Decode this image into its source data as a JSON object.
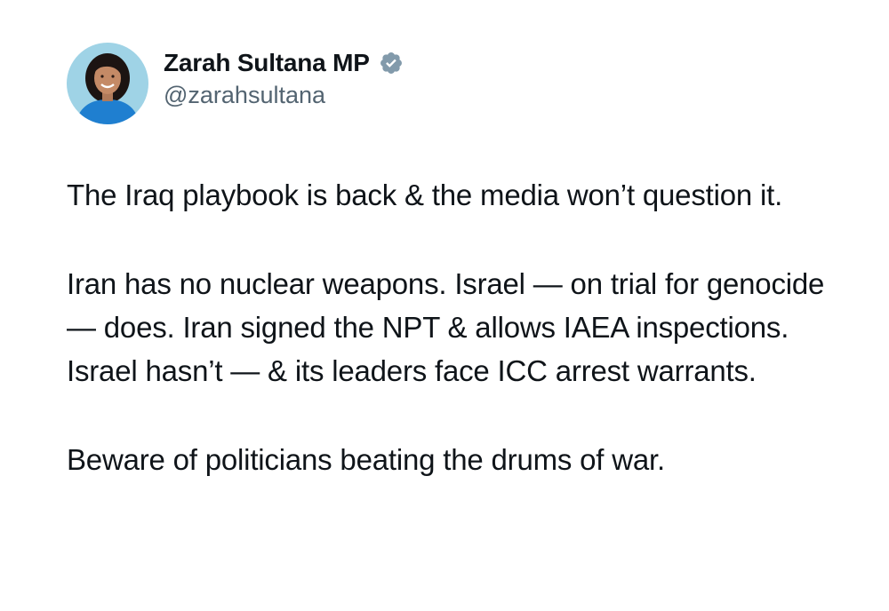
{
  "author": {
    "display_name": "Zarah Sultana MP",
    "handle": "@zarahsultana",
    "verified": true,
    "verified_badge_color": "#829aab",
    "avatar_icon": "profile-photo"
  },
  "tweet": {
    "paragraphs": [
      "The Iraq playbook is back & the media won’t question it.",
      "Iran has no nuclear weapons. Israel — on trial for genocide — does. Iran signed the NPT & allows IAEA inspections. Israel hasn’t — & its leaders face ICC arrest warrants.",
      "Beware of politicians beating the drums of war."
    ]
  },
  "colors": {
    "background": "#ffffff",
    "text": "#0f1419",
    "secondary_text": "#536471",
    "avatar_background": "#9fd3e6",
    "avatar_clothing": "#1f7fd0"
  }
}
